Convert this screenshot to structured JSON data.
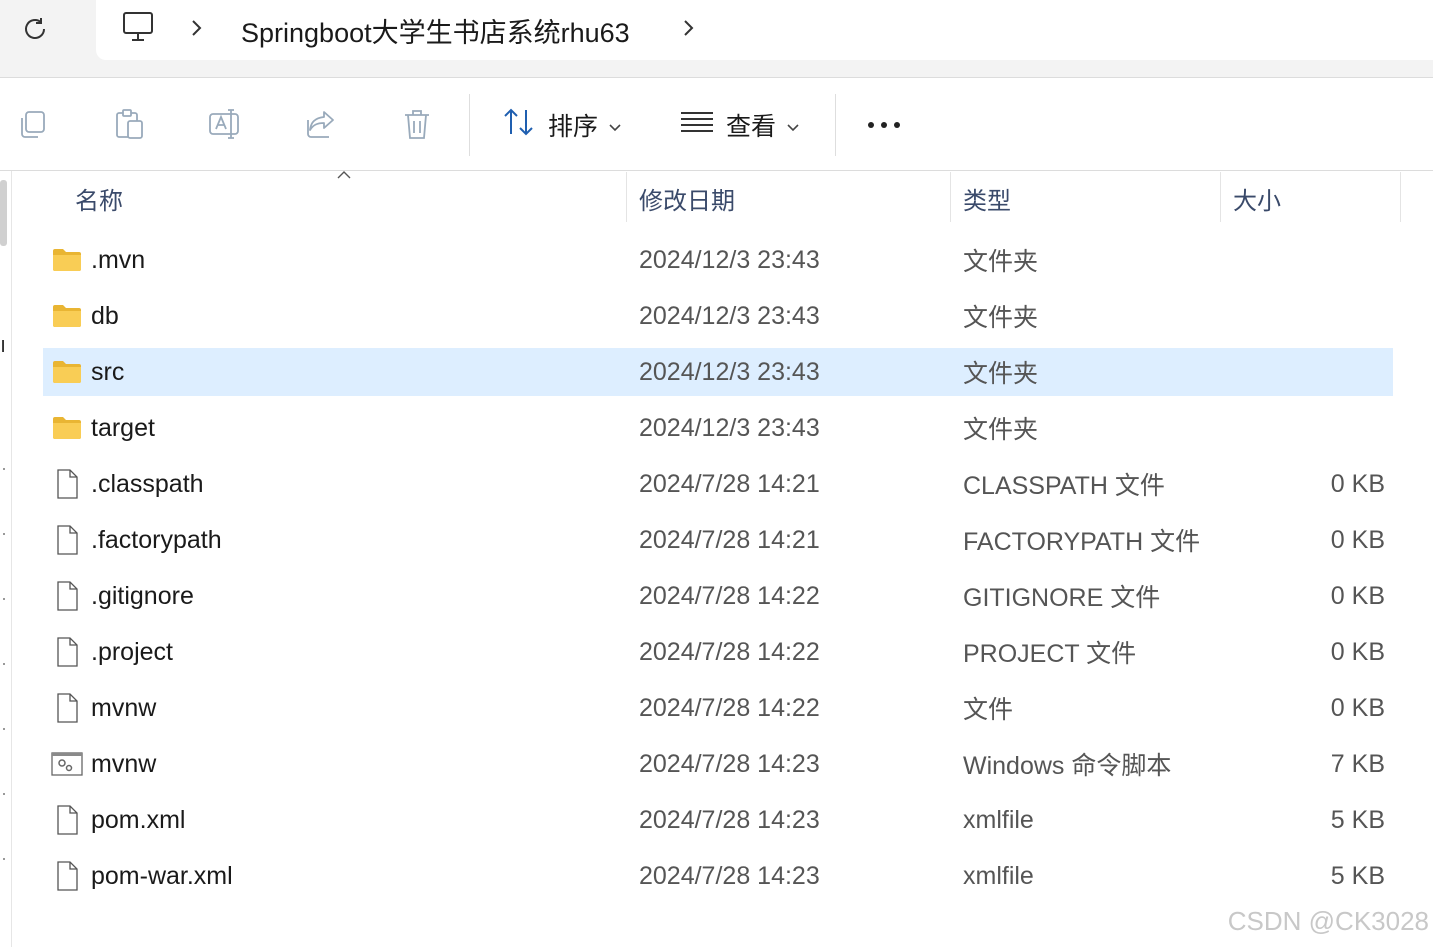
{
  "address": {
    "path": "Springboot大学生书店系统rhu63"
  },
  "toolbar": {
    "sort_label": "排序",
    "view_label": "查看"
  },
  "columns": {
    "name": "名称",
    "modified": "修改日期",
    "type": "类型",
    "size": "大小"
  },
  "files": [
    {
      "name": ".mvn",
      "modified": "2024/12/3 23:43",
      "type": "文件夹",
      "size": "",
      "icon": "folder-icon",
      "selected": false
    },
    {
      "name": "db",
      "modified": "2024/12/3 23:43",
      "type": "文件夹",
      "size": "",
      "icon": "folder-icon",
      "selected": false
    },
    {
      "name": "src",
      "modified": "2024/12/3 23:43",
      "type": "文件夹",
      "size": "",
      "icon": "folder-icon",
      "selected": true
    },
    {
      "name": "target",
      "modified": "2024/12/3 23:43",
      "type": "文件夹",
      "size": "",
      "icon": "folder-icon",
      "selected": false
    },
    {
      "name": ".classpath",
      "modified": "2024/7/28 14:21",
      "type": "CLASSPATH 文件",
      "size": "0 KB",
      "icon": "file-icon",
      "selected": false
    },
    {
      "name": ".factorypath",
      "modified": "2024/7/28 14:21",
      "type": "FACTORYPATH 文件",
      "size": "0 KB",
      "icon": "file-icon",
      "selected": false
    },
    {
      "name": ".gitignore",
      "modified": "2024/7/28 14:22",
      "type": "GITIGNORE 文件",
      "size": "0 KB",
      "icon": "file-icon",
      "selected": false
    },
    {
      "name": ".project",
      "modified": "2024/7/28 14:22",
      "type": "PROJECT 文件",
      "size": "0 KB",
      "icon": "file-icon",
      "selected": false
    },
    {
      "name": "mvnw",
      "modified": "2024/7/28 14:22",
      "type": "文件",
      "size": "0 KB",
      "icon": "file-icon",
      "selected": false
    },
    {
      "name": "mvnw",
      "modified": "2024/7/28 14:23",
      "type": "Windows 命令脚本",
      "size": "7 KB",
      "icon": "script-icon",
      "selected": false
    },
    {
      "name": "pom.xml",
      "modified": "2024/7/28 14:23",
      "type": "xmlfile",
      "size": "5 KB",
      "icon": "file-icon",
      "selected": false
    },
    {
      "name": "pom-war.xml",
      "modified": "2024/7/28 14:23",
      "type": "xmlfile",
      "size": "5 KB",
      "icon": "file-icon",
      "selected": false
    }
  ],
  "watermark": "CSDN @CK3028",
  "colors": {
    "selection": "#ddeeff",
    "folder": "#f7c948",
    "accent": "#1f6fd1"
  }
}
